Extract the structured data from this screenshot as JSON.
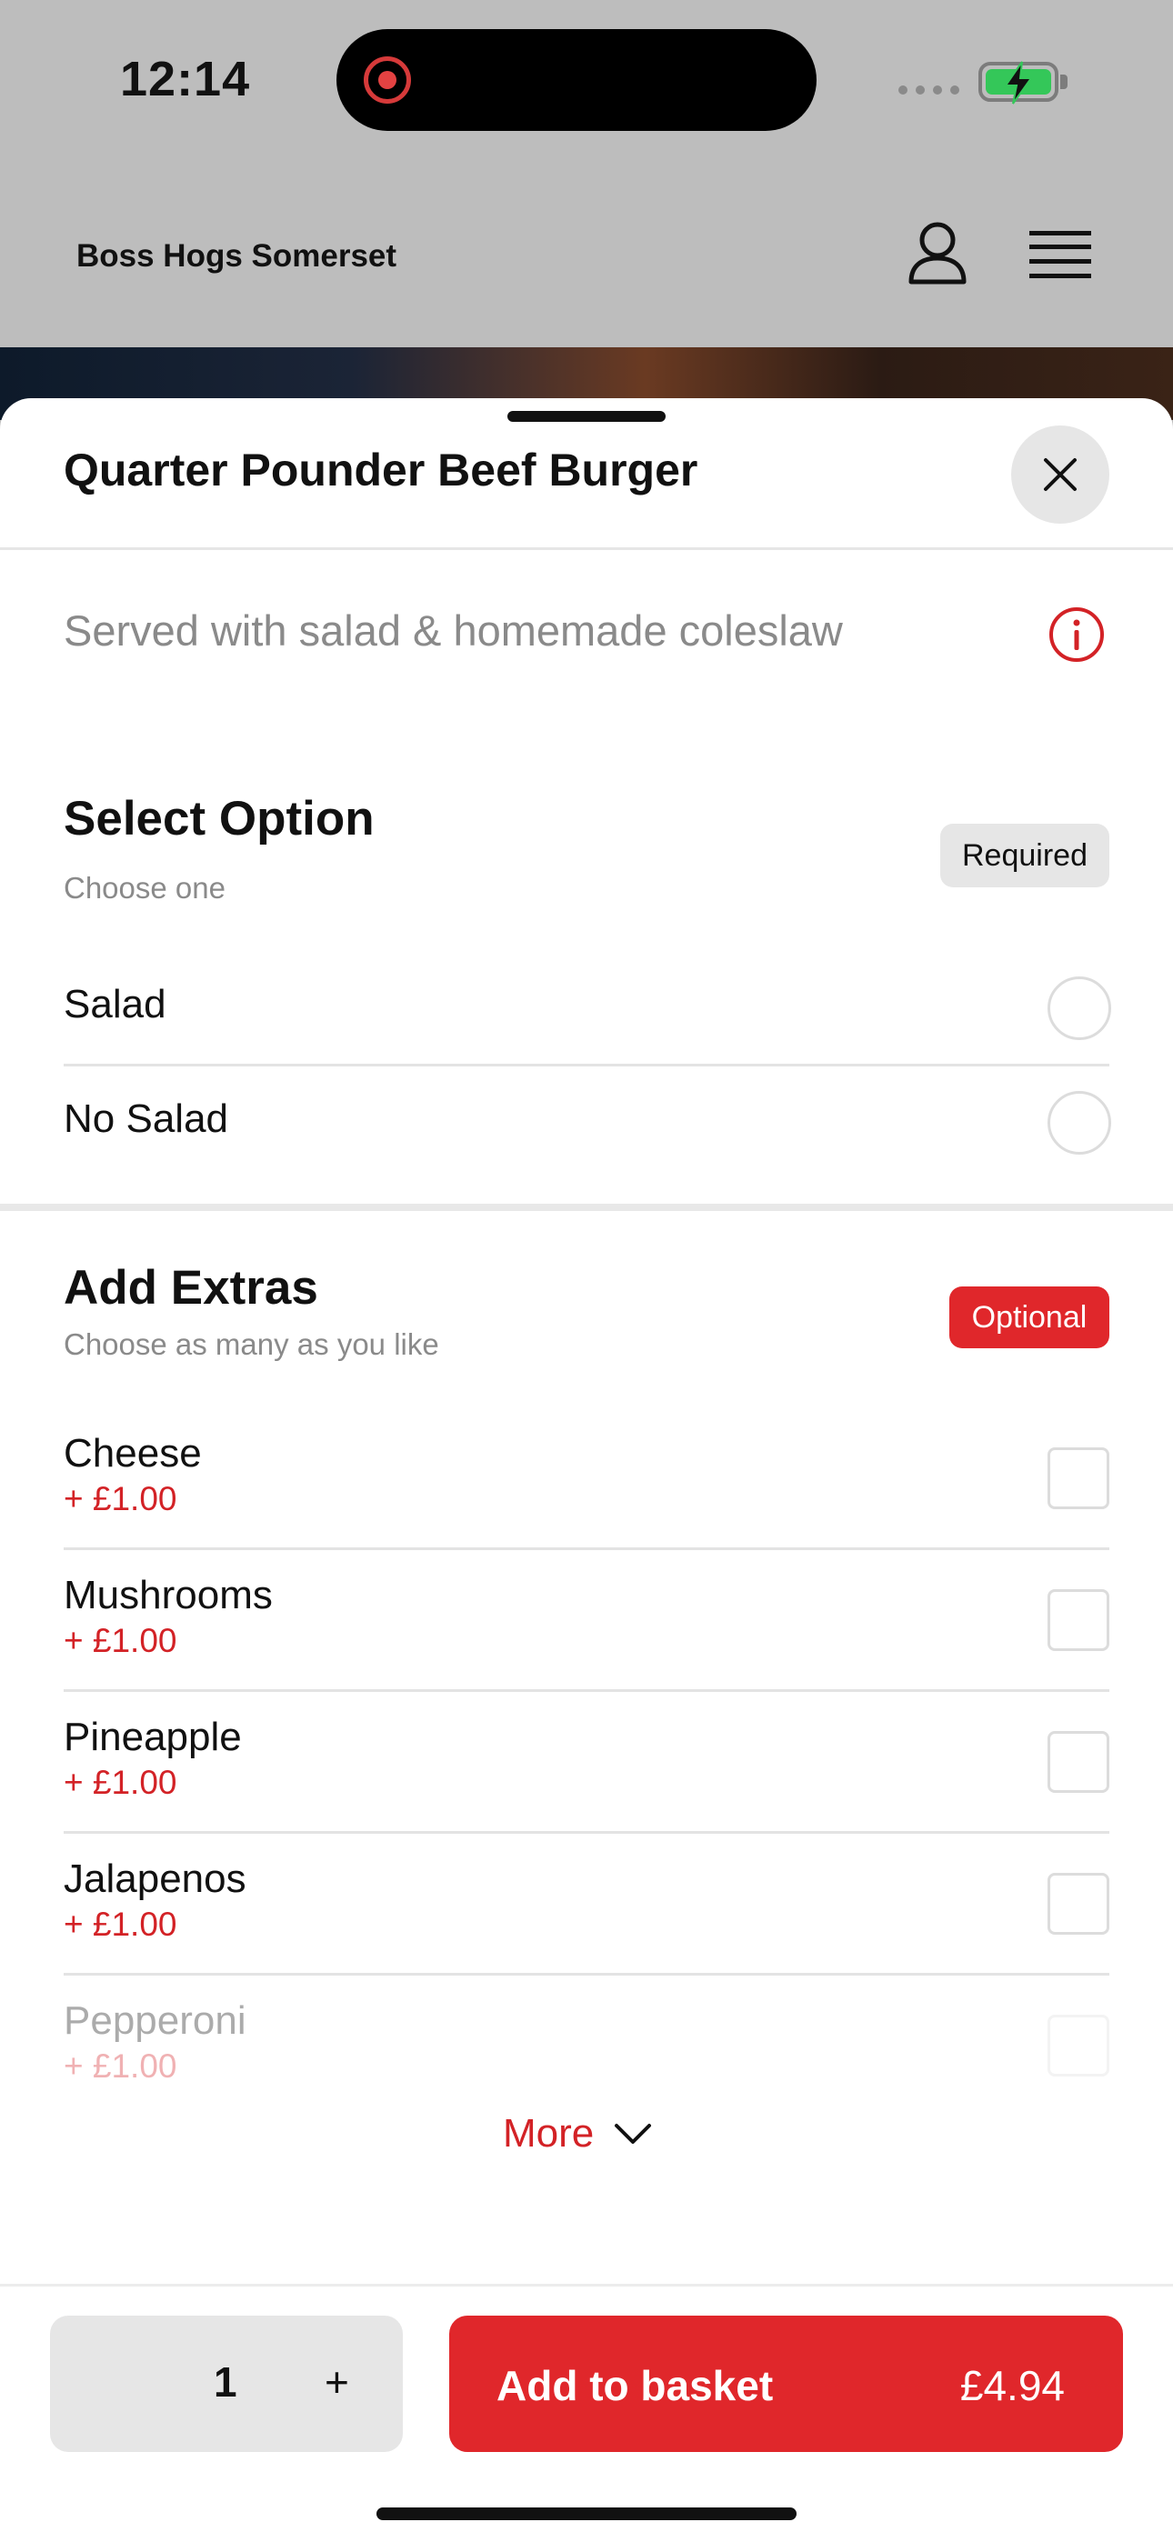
{
  "status_bar": {
    "time": "12:14"
  },
  "header": {
    "store_name": "Boss Hogs Somerset",
    "user_icon": "user-icon",
    "menu_icon": "hamburger-menu-icon"
  },
  "sheet": {
    "title": "Quarter Pounder Beef Burger",
    "description": "Served with salad & homemade coleslaw",
    "select_option": {
      "title": "Select Option",
      "subtitle": "Choose one",
      "badge": "Required",
      "options": [
        {
          "label": "Salad",
          "selected": false
        },
        {
          "label": "No Salad",
          "selected": false
        }
      ]
    },
    "extras": {
      "title": "Add Extras",
      "subtitle": "Choose as many as you like",
      "badge": "Optional",
      "items": [
        {
          "name": "Cheese",
          "price": "+ £1.00",
          "checked": false
        },
        {
          "name": "Mushrooms",
          "price": "+ £1.00",
          "checked": false
        },
        {
          "name": "Pineapple",
          "price": "+ £1.00",
          "checked": false
        },
        {
          "name": "Jalapenos",
          "price": "+ £1.00",
          "checked": false
        },
        {
          "name": "Pepperoni",
          "price": "+ £1.00",
          "checked": false
        }
      ],
      "more_label": "More"
    }
  },
  "footer": {
    "quantity": "1",
    "plus": "+",
    "add_label": "Add to basket",
    "price": "£4.94"
  },
  "colors": {
    "accent": "#e0272b",
    "price_text": "#d32226"
  }
}
